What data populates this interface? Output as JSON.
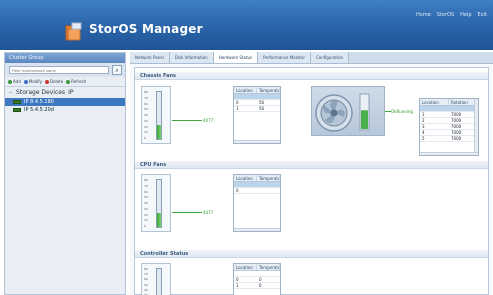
{
  "app": {
    "title": "StorOS Manager",
    "top_links": [
      "Home",
      "StorOS",
      "Help",
      "Exit"
    ]
  },
  "sidebar": {
    "title": "Cluster Group",
    "search": {
      "placeholder": "Filter host/network name"
    },
    "actions": [
      {
        "label": "Add",
        "color": "#3a9a3a"
      },
      {
        "label": "Modify",
        "color": "#3a6fc0"
      },
      {
        "label": "Delete",
        "color": "#cc3333"
      },
      {
        "label": "Refresh",
        "color": "#3a9a3a"
      }
    ],
    "tree": {
      "root_label": "Storage Devices",
      "root_suffix": "IP",
      "items": [
        {
          "label": "IP 8.4.5.180",
          "selected": true
        },
        {
          "label": "IP 5.4.5.20d",
          "selected": false
        }
      ]
    }
  },
  "tabs": [
    {
      "label": "Network Panel",
      "active": false
    },
    {
      "label": "Disk Information",
      "active": false
    },
    {
      "label": "Hardware Status",
      "active": true
    },
    {
      "label": "Performance Monitor",
      "active": false
    },
    {
      "label": "Configuration",
      "active": false
    }
  ],
  "sections": [
    {
      "id": "chassis",
      "title": "Chassis Fans",
      "meter": {
        "ticks": [
          "80",
          "70",
          "60",
          "50",
          "40",
          "30",
          "20",
          "10",
          "0"
        ],
        "reading": "4077",
        "level": 0.3
      },
      "grid": {
        "headers": [
          "Location",
          "Temperature"
        ],
        "rows": [
          [
            "0",
            "56"
          ],
          [
            "1",
            "56"
          ]
        ],
        "selected": 0
      },
      "fan": {
        "reading": "OkRunning",
        "level": 0.55
      },
      "fan_grid": {
        "headers": [
          "Location",
          "Rotation"
        ],
        "rows": [
          [
            "1",
            "7000"
          ],
          [
            "2",
            "7000"
          ],
          [
            "3",
            "7000"
          ],
          [
            "4",
            "7000"
          ],
          [
            "5",
            "7000"
          ]
        ],
        "selected": 0
      }
    },
    {
      "id": "cpu",
      "title": "CPU Fans",
      "meter": {
        "ticks": [
          "80",
          "70",
          "60",
          "50",
          "40",
          "30",
          "20",
          "10",
          "0"
        ],
        "reading": "4077",
        "level": 0.3
      },
      "grid": {
        "headers": [
          "Location",
          "Temperature"
        ],
        "rows": [
          [
            "0",
            ""
          ]
        ],
        "selected": 0
      }
    },
    {
      "id": "controller",
      "title": "Controller Status",
      "meter": {
        "ticks": [
          "80",
          "70",
          "60",
          "50",
          "40",
          "30"
        ],
        "reading": "",
        "level": 0
      },
      "grid": {
        "headers": [
          "Location",
          "Temperature"
        ],
        "rows": [
          [
            "0",
            "0"
          ],
          [
            "1",
            "0"
          ]
        ],
        "selected": -1
      }
    }
  ]
}
